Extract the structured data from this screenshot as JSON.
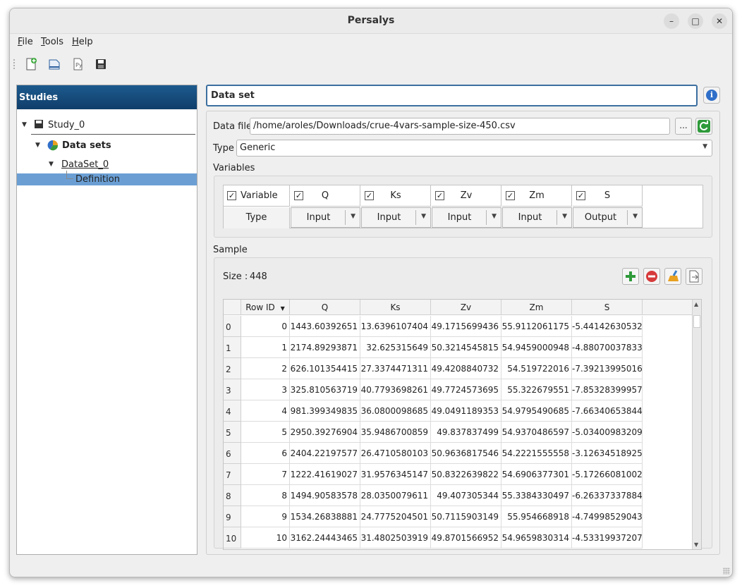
{
  "window": {
    "title": "Persalys",
    "minimize": "–",
    "maximize": "□",
    "close": "✕"
  },
  "menu": [
    {
      "label": "File",
      "accel": "F",
      "rest": "ile"
    },
    {
      "label": "Tools",
      "accel": "T",
      "rest": "ools"
    },
    {
      "label": "Help",
      "accel": "H",
      "rest": "elp"
    }
  ],
  "toolbar": {
    "icons": [
      "new-study-icon",
      "open-study-icon",
      "import-script-icon",
      "save-icon"
    ]
  },
  "studies": {
    "header": "Studies",
    "tree": {
      "study": "Study_0",
      "datasets": "Data sets",
      "dataset": "DataSet_0",
      "definition": "Definition"
    }
  },
  "page": {
    "title": "Data set",
    "data_file_label": "Data file",
    "data_file_value": "/home/aroles/Downloads/crue-4vars-sample-size-450.csv",
    "browse_label": "...",
    "type_label": "Type",
    "type_value": "Generic",
    "variables_label": "Variables",
    "sample_label": "Sample",
    "size_label": "Size :",
    "size_value": "448"
  },
  "variables": {
    "header_label": "Variable",
    "type_label": "Type",
    "columns": [
      {
        "name": "Q",
        "checked": true,
        "type": "Input"
      },
      {
        "name": "Ks",
        "checked": true,
        "type": "Input"
      },
      {
        "name": "Zv",
        "checked": true,
        "type": "Input"
      },
      {
        "name": "Zm",
        "checked": true,
        "type": "Input"
      },
      {
        "name": "S",
        "checked": true,
        "type": "Output"
      }
    ]
  },
  "sample": {
    "headers": [
      "Row ID",
      "Q",
      "Ks",
      "Zv",
      "Zm",
      "S"
    ],
    "rows": [
      [
        "0",
        "0",
        "1443.60392651",
        "13.6396107404",
        "49.1715699436",
        "55.9112061175",
        "-5.44142630532"
      ],
      [
        "1",
        "1",
        "2174.89293871",
        "32.625315649",
        "50.3214545815",
        "54.9459000948",
        "-4.88070037833"
      ],
      [
        "2",
        "2",
        "626.101354415",
        "27.3374471311",
        "49.4208840732",
        "54.519722016",
        "-7.39213995016"
      ],
      [
        "3",
        "3",
        "325.810563719",
        "40.7793698261",
        "49.7724573695",
        "55.322679551",
        "-7.85328399957"
      ],
      [
        "4",
        "4",
        "981.399349835",
        "36.0800098685",
        "49.0491189353",
        "54.9795490685",
        "-7.66340653844"
      ],
      [
        "5",
        "5",
        "2950.39276904",
        "35.9486700859",
        "49.837837499",
        "54.9370486597",
        "-5.03400983209"
      ],
      [
        "6",
        "6",
        "2404.22197577",
        "26.4710580103",
        "50.9636817546",
        "54.2221555558",
        "-3.12634518925"
      ],
      [
        "7",
        "7",
        "1222.41619027",
        "31.9576345147",
        "50.8322639822",
        "54.6906377301",
        "-5.17266081002"
      ],
      [
        "8",
        "8",
        "1494.90583578",
        "28.0350079611",
        "49.407305344",
        "55.3384330497",
        "-6.26337337884"
      ],
      [
        "9",
        "9",
        "1534.26838881",
        "24.7775204501",
        "50.7115903149",
        "55.954668918",
        "-4.74998529043"
      ],
      [
        "10",
        "10",
        "3162.24443465",
        "31.4802503919",
        "49.8701566952",
        "54.9659830314",
        "-4.53319937207"
      ]
    ]
  },
  "colors": {
    "accent": "#1d5a8e",
    "selection": "#6b9fd4",
    "focus": "#3c6fa0"
  }
}
